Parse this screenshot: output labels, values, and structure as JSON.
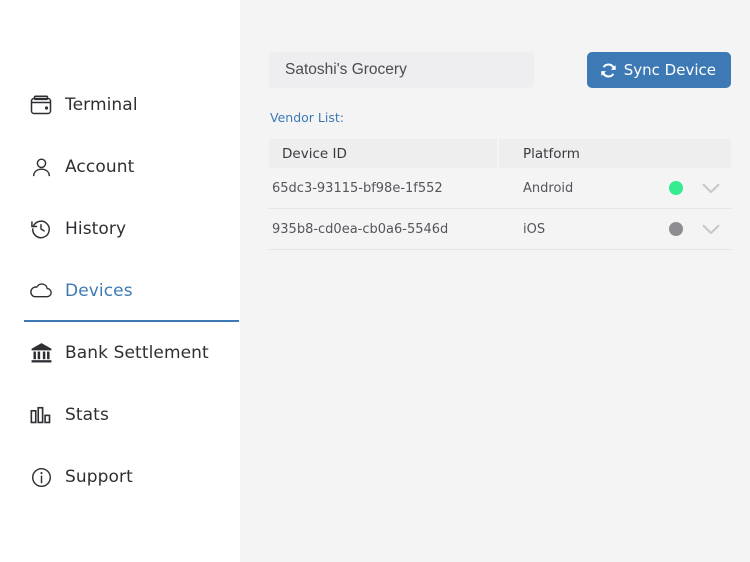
{
  "sidebar": {
    "items": [
      {
        "label": "Terminal",
        "icon": "wallet-icon",
        "active": false
      },
      {
        "label": "Account",
        "icon": "user-icon",
        "active": false
      },
      {
        "label": "History",
        "icon": "history-clock-icon",
        "active": false
      },
      {
        "label": "Devices",
        "icon": "cloud-icon",
        "active": true
      },
      {
        "label": "Bank Settlement",
        "icon": "bank-icon",
        "active": false
      },
      {
        "label": "Stats",
        "icon": "bar-chart-icon",
        "active": false
      },
      {
        "label": "Support",
        "icon": "info-circle-icon",
        "active": false
      }
    ]
  },
  "toolbar": {
    "search_value": "Satoshi's Grocery",
    "search_placeholder": "Satoshi's Grocery",
    "sync_label": "Sync Device",
    "sync_icon": "sync-refresh-icon"
  },
  "main": {
    "vendor_list_label": "Vendor List:"
  },
  "table": {
    "columns": [
      "Device ID",
      "Platform"
    ],
    "rows": [
      {
        "device_id": "65dc3-93115-bf98e-1f552",
        "platform": "Android",
        "status": "online",
        "status_color": "#34eb8f",
        "expand_icon": "chevron-down-icon"
      },
      {
        "device_id": "935b8-cd0ea-cb0a6-5546d",
        "platform": "iOS",
        "status": "offline",
        "status_color": "#8e8e92",
        "expand_icon": "chevron-down-icon"
      }
    ]
  },
  "colors": {
    "accent": "#3d7ab5",
    "sidebar_bg": "#ffffff",
    "main_bg": "#f4f4f4",
    "table_header_bg": "#eeeeef",
    "input_bg": "#eeeef0"
  }
}
